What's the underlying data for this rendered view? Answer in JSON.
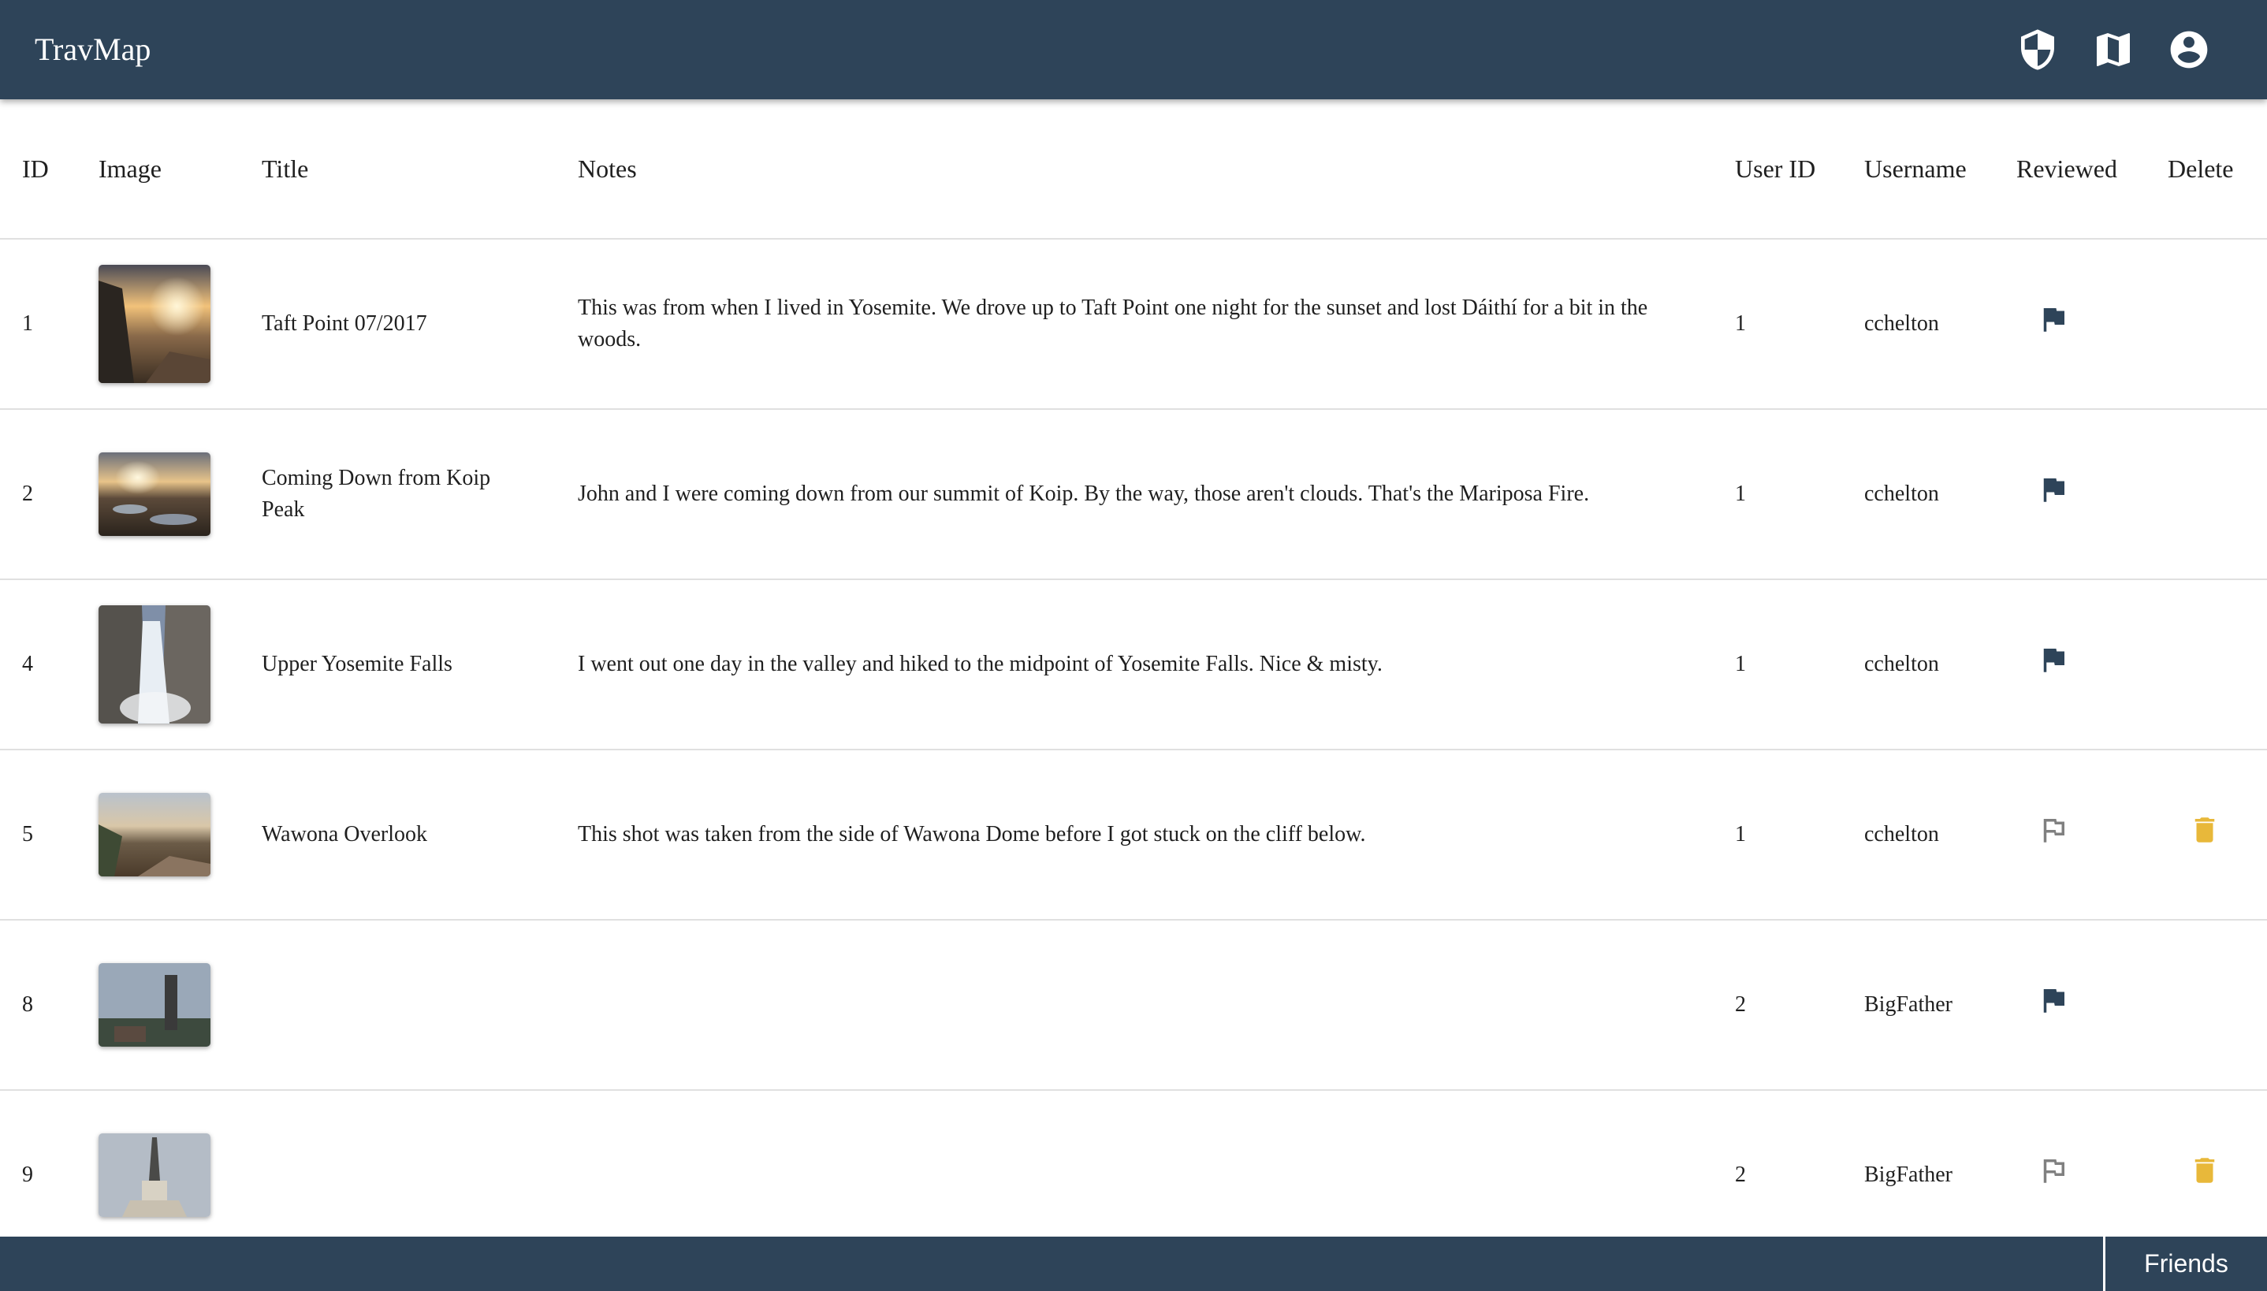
{
  "app": {
    "title": "TravMap"
  },
  "header": {
    "icons": [
      "shield-icon",
      "map-icon",
      "account-circle-icon"
    ]
  },
  "table": {
    "columns": {
      "id": "ID",
      "image": "Image",
      "title": "Title",
      "notes": "Notes",
      "user_id": "User ID",
      "username": "Username",
      "reviewed": "Reviewed",
      "delete": "Delete"
    },
    "rows": [
      {
        "id": "1",
        "title": "Taft Point 07/2017",
        "notes": "This was from when I lived in Yosemite. We drove up to Taft Point one night for the sunset and lost Dáithí for a bit in the woods.",
        "user_id": "1",
        "username": "cchelton",
        "reviewed": true,
        "deletable": false
      },
      {
        "id": "2",
        "title": "Coming Down from Koip Peak",
        "notes": "John and I were coming down from our summit of Koip. By the way, those aren't clouds. That's the Mariposa Fire.",
        "user_id": "1",
        "username": "cchelton",
        "reviewed": true,
        "deletable": false
      },
      {
        "id": "4",
        "title": "Upper Yosemite Falls",
        "notes": "I went out one day in the valley and hiked to the midpoint of Yosemite Falls. Nice & misty.",
        "user_id": "1",
        "username": "cchelton",
        "reviewed": true,
        "deletable": false
      },
      {
        "id": "5",
        "title": "Wawona Overlook",
        "notes": "This shot was taken from the side of Wawona Dome before I got stuck on the cliff below.",
        "user_id": "1",
        "username": "cchelton",
        "reviewed": false,
        "deletable": true
      },
      {
        "id": "8",
        "title": "",
        "notes": "",
        "user_id": "2",
        "username": "BigFather",
        "reviewed": true,
        "deletable": false
      },
      {
        "id": "9",
        "title": "",
        "notes": "",
        "user_id": "2",
        "username": "BigFather",
        "reviewed": false,
        "deletable": true
      }
    ]
  },
  "footer": {
    "friends_label": "Friends"
  },
  "colors": {
    "header_bg": "#2e4459",
    "flag_reviewed": "#2e4459",
    "flag_unreviewed": "#808080",
    "trash": "#e8b83a"
  }
}
